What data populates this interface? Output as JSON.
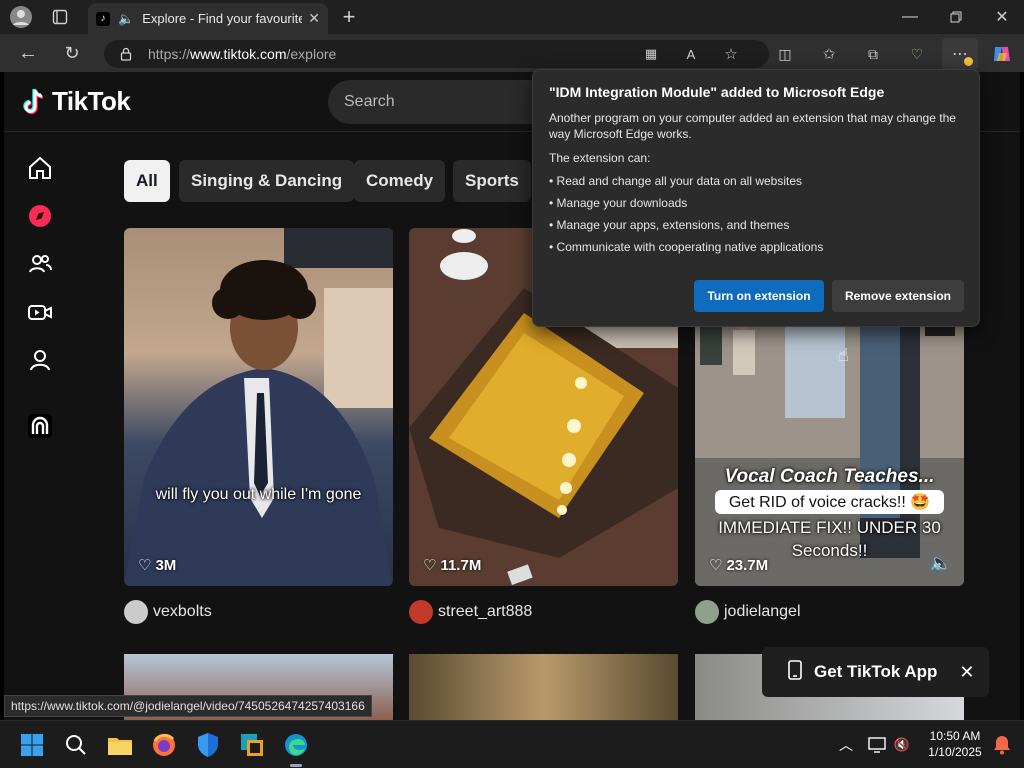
{
  "browser": {
    "tab_title": "Explore - Find your favourite",
    "url_scheme": "https://",
    "url_host": "www.tiktok.com",
    "url_path": "/explore",
    "status_url": "https://www.tiktok.com/@jodielangel/video/7450526474257403166"
  },
  "tiktok": {
    "logo_text": "TikTok",
    "search_placeholder": "Search",
    "chips": [
      {
        "label": "All",
        "active": true
      },
      {
        "label": "Singing & Dancing",
        "active": false
      },
      {
        "label": "Comedy",
        "active": false
      },
      {
        "label": "Sports",
        "active": false
      }
    ],
    "videos": [
      {
        "likes": "3M",
        "caption": "will fly you out while I'm gone",
        "author": "vexbolts"
      },
      {
        "likes": "11.7M",
        "caption": "",
        "author": "street_art888"
      },
      {
        "likes": "23.7M",
        "caption_title": "Vocal Coach Teaches...",
        "caption": "Get RID of voice cracks!! 🤩",
        "caption2": "IMMEDIATE FIX!! UNDER 30",
        "caption3": "Seconds!!",
        "author": "jodielangel"
      }
    ],
    "get_app_label": "Get TikTok App"
  },
  "popup": {
    "title": "\"IDM Integration Module\" added to Microsoft Edge",
    "body": "Another program on your computer added an extension that may change the way Microsoft Edge works.",
    "can_label": "The extension can:",
    "items": [
      "• Read and change all your data on all websites",
      "• Manage your downloads",
      "• Manage your apps, extensions, and themes",
      "• Communicate with cooperating native applications"
    ],
    "primary_button": "Turn on extension",
    "secondary_button": "Remove extension"
  },
  "taskbar": {
    "time": "10:50 AM",
    "date": "1/10/2025"
  },
  "colors": {
    "primary_button": "#0f6cbd",
    "tiktok_red": "#fe2c55",
    "tiktok_cyan": "#25f4ee"
  }
}
